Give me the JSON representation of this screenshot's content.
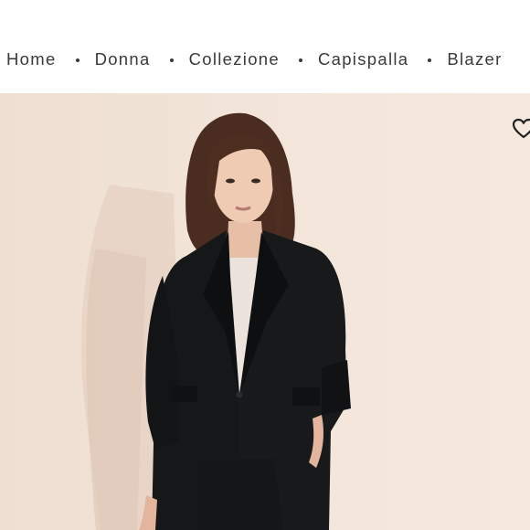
{
  "breadcrumb": {
    "items": [
      "Home",
      "Donna",
      "Collezione",
      "Capispalla",
      "Blazer"
    ]
  },
  "product_image": {
    "alt": "",
    "background_color": "#f1e3d7",
    "jacket_color": "#151719"
  },
  "icons": {
    "favorite": "heart-outline-icon"
  }
}
